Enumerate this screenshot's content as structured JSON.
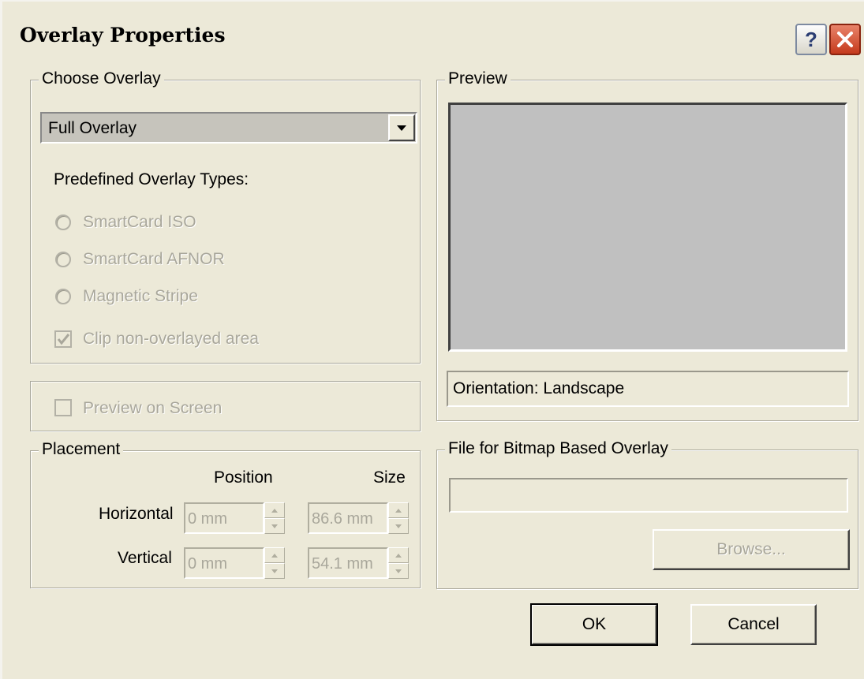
{
  "window": {
    "title": "Overlay Properties",
    "help_glyph": "?",
    "close_icon": "close-icon"
  },
  "choose_overlay": {
    "legend": "Choose Overlay",
    "selected": "Full Overlay",
    "predefined_label": "Predefined Overlay Types:",
    "options": [
      "SmartCard ISO",
      "SmartCard AFNOR",
      "Magnetic Stripe"
    ],
    "clip_label": "Clip non-overlayed area",
    "clip_checked": true
  },
  "preview_on_screen": {
    "label": "Preview on Screen",
    "checked": false
  },
  "placement": {
    "legend": "Placement",
    "position_header": "Position",
    "size_header": "Size",
    "horizontal_label": "Horizontal",
    "vertical_label": "Vertical",
    "horizontal_position": "0 mm",
    "horizontal_size": "86.6 mm",
    "vertical_position": "0 mm",
    "vertical_size": "54.1 mm"
  },
  "preview": {
    "legend": "Preview",
    "orientation": "Orientation: Landscape",
    "area_color": "#c0c0c0"
  },
  "bitmap_file": {
    "legend": "File for Bitmap Based Overlay",
    "path": "",
    "browse_label": "Browse..."
  },
  "buttons": {
    "ok": "OK",
    "cancel": "Cancel"
  }
}
